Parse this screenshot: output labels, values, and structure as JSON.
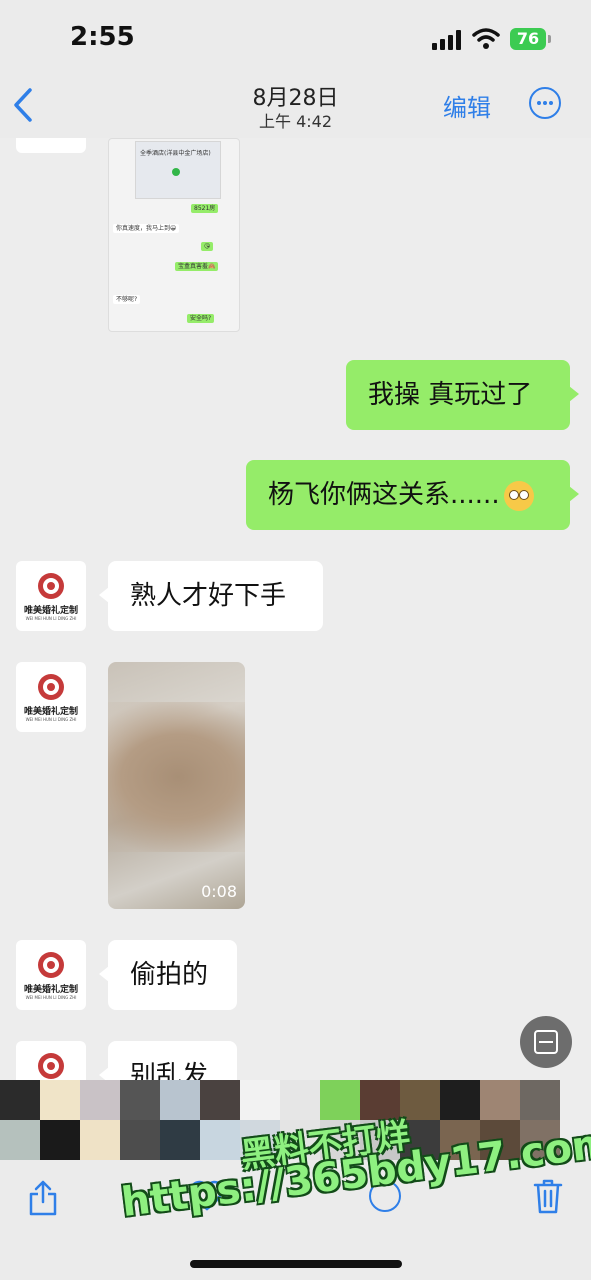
{
  "status_bar": {
    "time": "2:55",
    "battery": "76"
  },
  "nav": {
    "back_icon": "chevron-left-icon",
    "date": "8月28日",
    "time": "上午 4:42",
    "edit": "编辑",
    "more_icon": "ellipsis-circle-icon"
  },
  "avatar": {
    "brand": "唯美婚礼定制",
    "brand_sub": "WEI MEI HUN LI DING ZHI"
  },
  "quoted_screenshot": {
    "hotel": "全季酒店(洋县中金广场店)",
    "msgs": [
      "8521房",
      "你真速度，我马上到😀",
      "😘",
      "宝盒真害羞🙈",
      "不够呢?",
      "安全吗?"
    ]
  },
  "messages": [
    {
      "side": "out",
      "text": "我操 真玩过了"
    },
    {
      "side": "out",
      "text": "杨飞你俩这关系......",
      "emoji": "flushed-face-icon"
    },
    {
      "side": "in",
      "text": "熟人才好下手"
    },
    {
      "side": "in",
      "type": "video",
      "duration": "0:08"
    },
    {
      "side": "in",
      "text": "偷拍的"
    },
    {
      "side": "in",
      "text": "别乱发"
    }
  ],
  "toolbar": {
    "share_icon": "share-icon",
    "like_icon": "heart-icon",
    "info_icon": "info-icon",
    "delete_icon": "trash-icon",
    "scan_icon": "live-text-icon"
  },
  "watermark": {
    "line1": "黑料不打烊",
    "line2": "https://365bdy17.com"
  },
  "colors": {
    "accent": "#2f7fe8",
    "bubble_out": "#95ec69",
    "bubble_in": "#ffffff",
    "background": "#ededed"
  }
}
